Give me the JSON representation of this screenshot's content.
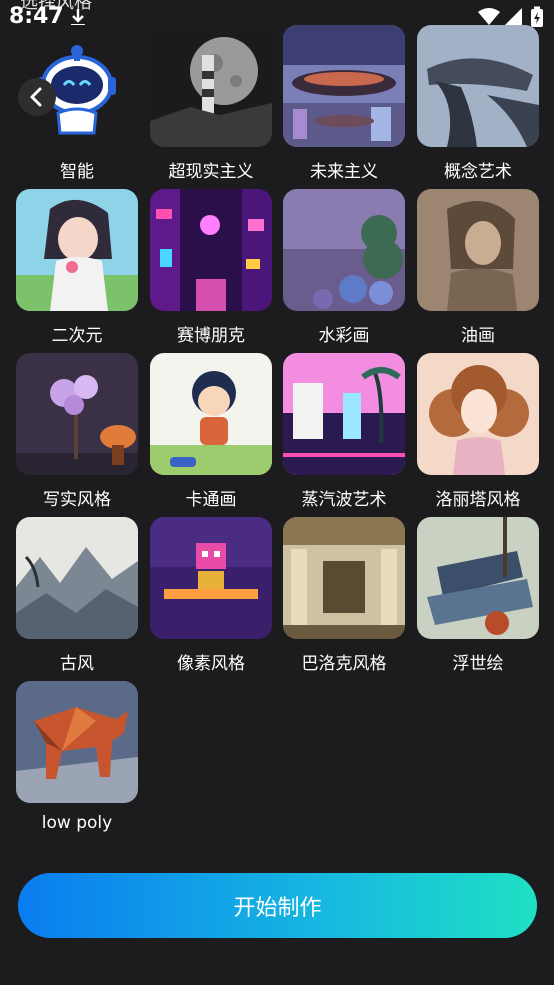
{
  "status": {
    "time": "8:47"
  },
  "header": {
    "title": "选择风格"
  },
  "styles": [
    {
      "label": "智能"
    },
    {
      "label": "超现实主义"
    },
    {
      "label": "未来主义"
    },
    {
      "label": "概念艺术"
    },
    {
      "label": "二次元"
    },
    {
      "label": "赛博朋克"
    },
    {
      "label": "水彩画"
    },
    {
      "label": "油画"
    },
    {
      "label": "写实风格"
    },
    {
      "label": "卡通画"
    },
    {
      "label": "蒸汽波艺术"
    },
    {
      "label": "洛丽塔风格"
    },
    {
      "label": "古风"
    },
    {
      "label": "像素风格"
    },
    {
      "label": "巴洛克风格"
    },
    {
      "label": "浮世绘"
    },
    {
      "label": "low poly"
    }
  ],
  "action": {
    "start_label": "开始制作"
  },
  "colors": {
    "background": "#1c1c1e",
    "button_start": "#0a7cf0",
    "button_end": "#1fe0c4"
  }
}
